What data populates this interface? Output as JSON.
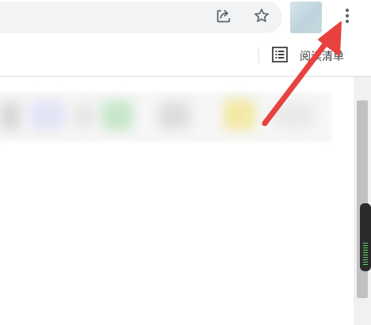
{
  "toolbar": {
    "share_icon": "share-icon",
    "bookmark_icon": "star-icon",
    "menu_icon": "three-dots-vertical-icon"
  },
  "bookmarks_bar": {
    "reading_list_icon": "reading-list-icon",
    "reading_list_label": "阅读清单"
  },
  "colors": {
    "annotation_arrow": "#e8413f",
    "omnibox_bg": "#f1f3f4",
    "scrollbar_thumb": "#c1c1c1"
  }
}
